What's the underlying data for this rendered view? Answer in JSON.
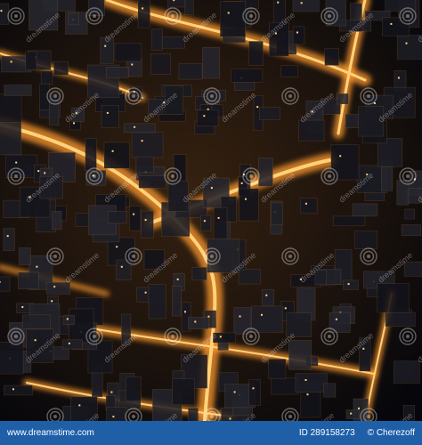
{
  "image": {
    "subject": "aerial night view of dense city with glowing roads",
    "palette": {
      "road_glow": "#ff9a2e",
      "road_core": "#ffd27a",
      "buildings": "#1a1b22",
      "shadow": "#07070b"
    }
  },
  "watermark": {
    "text": "dreamstime",
    "icon": "dreamstime-spiral-icon"
  },
  "footer": {
    "site": "www.dreamstime.com",
    "id_label": "ID 289158273",
    "author_label": "© Cherezoff",
    "background": "#1f5fa8"
  }
}
